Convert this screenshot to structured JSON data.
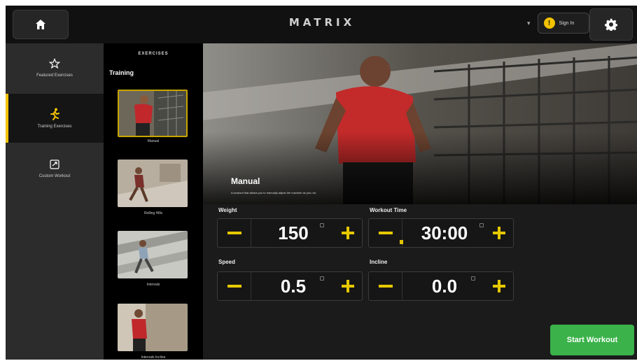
{
  "header": {
    "brand": "MATRIX",
    "signin_badge": "!",
    "signin_label": "Sign In",
    "signin_chevron": "▾"
  },
  "sidebar": {
    "items": [
      {
        "label": "Featured Exercises",
        "icon": "star-icon"
      },
      {
        "label": "Training Exercises",
        "icon": "runner-icon"
      },
      {
        "label": "Custom Workout",
        "icon": "custom-workout-icon"
      }
    ],
    "selected": "Training Exercises"
  },
  "exercises": {
    "title": "EXERCISES",
    "section": "Training",
    "items": [
      {
        "label": "Manual"
      },
      {
        "label": "Rolling Hills"
      },
      {
        "label": "Intervals"
      },
      {
        "label": "Intervals Incline"
      }
    ],
    "selected": "Manual"
  },
  "hero": {
    "title": "Manual",
    "description": "A workout that allows you to manually adjust the machine as you run."
  },
  "controls": {
    "weight": {
      "label": "Weight",
      "value": "150"
    },
    "workout_time": {
      "label": "Workout Time",
      "value": "30:00"
    },
    "speed": {
      "label": "Speed",
      "value": "0.5"
    },
    "incline": {
      "label": "Incline",
      "value": "0.0"
    },
    "minus_glyph": "−",
    "plus_glyph": "+"
  },
  "start_button": {
    "label": "Start Workout"
  },
  "colors": {
    "accent": "#f2c200",
    "start": "#3bb24a",
    "background": "#1b1b1b"
  }
}
